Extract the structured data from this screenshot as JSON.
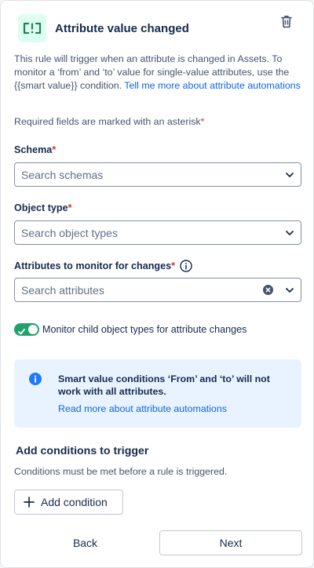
{
  "header": {
    "title": "Attribute value changed",
    "trigger_icon": "attribute-trigger-icon",
    "delete_icon": "trash-icon",
    "trigger_icon_color": "#1f845a"
  },
  "description": {
    "text": "This rule will trigger when an attribute is changed in Assets. To monitor a ‘from’ and ‘to’ value for single-value attributes, use the {{smart value}} condition. ",
    "link": "Tell me more about attribute automations"
  },
  "required_note": {
    "text": "Required fields are marked with an asterisk",
    "asterisk": "*"
  },
  "fields": {
    "schema": {
      "label": "Schema",
      "asterisk": "*",
      "placeholder": "Search schemas",
      "value": ""
    },
    "object_type": {
      "label": "Object type",
      "asterisk": "*",
      "placeholder": "Search object types",
      "value": ""
    },
    "attributes": {
      "label": "Attributes to monitor for changes",
      "asterisk": "*",
      "placeholder": "Search attributes",
      "value": ""
    }
  },
  "toggle": {
    "label": "Monitor child object types for attribute changes",
    "checked": true,
    "color": "#22a06b"
  },
  "info": {
    "message": "Smart value conditions ‘From’ and ‘to’ will not work with all attributes.",
    "link": "Read more about attribute automations",
    "background": "#e9f2ff",
    "icon_color": "#1d7afc"
  },
  "conditions": {
    "title": "Add conditions to trigger",
    "description": "Conditions must be met before a rule is triggered.",
    "add_label": "Add condition"
  },
  "footer": {
    "back_label": "Back",
    "next_label": "Next"
  },
  "colors": {
    "link": "#0c66e4",
    "asterisk": "#c9372c",
    "text": "#172b4d",
    "subtle_text": "#44546f"
  }
}
